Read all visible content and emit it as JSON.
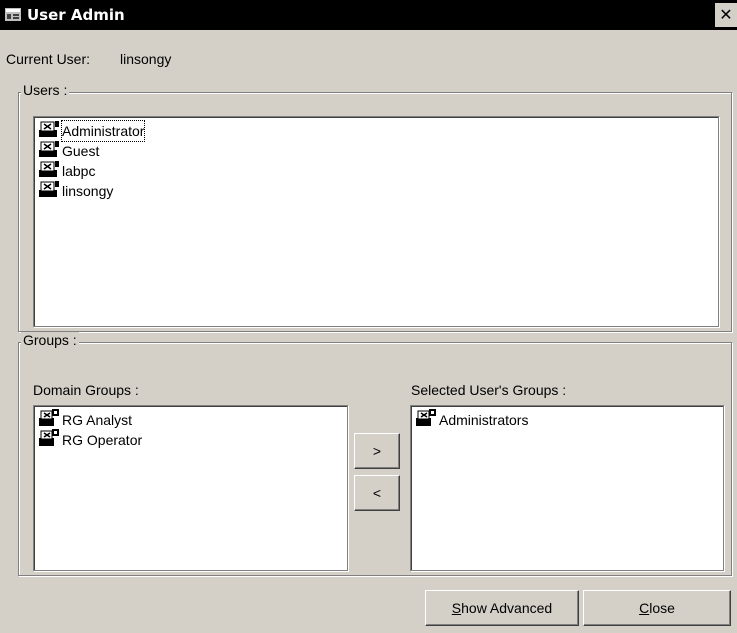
{
  "window": {
    "title": "User Admin",
    "close_glyph": "✕"
  },
  "current_user": {
    "label": "Current User:",
    "value": "linsongy"
  },
  "users": {
    "legend": "Users :",
    "items": [
      {
        "label": "Administrator",
        "icon": "user-icon",
        "selected": true
      },
      {
        "label": "Guest",
        "icon": "user-icon"
      },
      {
        "label": "labpc",
        "icon": "user-icon"
      },
      {
        "label": "linsongy",
        "icon": "user-icon"
      }
    ]
  },
  "groups": {
    "legend": "Groups :",
    "domain_label": "Domain Groups :",
    "selected_label": "Selected User's Groups :",
    "domain_items": [
      {
        "label": "RG Analyst",
        "icon": "group-icon"
      },
      {
        "label": "RG Operator",
        "icon": "group-icon"
      }
    ],
    "selected_items": [
      {
        "label": "Administrators",
        "icon": "group-icon"
      }
    ],
    "add_label": ">",
    "remove_label": "<"
  },
  "buttons": {
    "show_advanced_mnemonic": "S",
    "show_advanced_rest": "how Advanced",
    "close_mnemonic": "C",
    "close_rest": "lose"
  }
}
